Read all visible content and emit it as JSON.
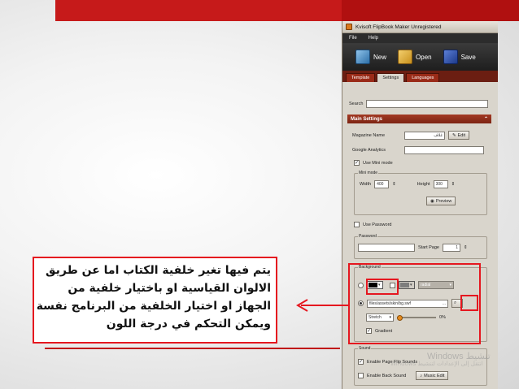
{
  "window": {
    "title": "Kvisoft FlipBook Maker  Unregistered"
  },
  "menu": [
    "File",
    "Help"
  ],
  "toolbar": {
    "new_label": "New",
    "open_label": "Open",
    "save_label": "Save"
  },
  "tabs": [
    {
      "label": "Template",
      "active": false
    },
    {
      "label": "Settings",
      "active": true
    },
    {
      "label": "Languages",
      "active": false
    }
  ],
  "search": {
    "label": "Search",
    "value": ""
  },
  "main_settings": {
    "title": "Main Settings",
    "magazine_name": {
      "label": "Magazine Name",
      "value": "غلاف",
      "edit_label": "Edit"
    },
    "google_analytics": {
      "label": "Google Analytics",
      "value": ""
    },
    "use_mini_mode": {
      "label": "Use Mini mode",
      "checked": true
    },
    "mini_mode": {
      "group_label": "Mini mode",
      "width_label": "Width",
      "width_value": "400",
      "height_label": "Height",
      "height_value": "300",
      "preview_label": "Preview"
    },
    "use_password": {
      "label": "Use Password",
      "checked": false
    },
    "password": {
      "group_label": "Password",
      "value": "",
      "start_page_label": "Start Page",
      "start_page_value": "1"
    },
    "background": {
      "group_label": "Background",
      "color1": "#000000",
      "color2": "#7d7d7d",
      "gradient_type": "radial",
      "file_path": "files/assets/skin/bg.swf",
      "browse_label": "...",
      "stretch_label": "Stretch",
      "opacity_percent": "0%",
      "gradient_label": "Gradient",
      "gradient_checked": true
    },
    "sound": {
      "group_label": "Sound",
      "flip_label": "Enable Page Flip Sounds",
      "flip_checked": true,
      "back_label": "Enable Back Sound",
      "back_checked": false,
      "music_edit_label": "Music Edit"
    }
  },
  "callout": {
    "lines": [
      "يتم فيها تغير خلفية الكتاب اما عن طريق",
      "الالوان القياسية او باختيار خلفية من",
      "الجهاز او اختيار الخلفية من البرنامج نفسة",
      "ويمكن التحكم في درجة اللون"
    ]
  },
  "watermark": {
    "line1": "Windows تنشيط",
    "line2": "انتقل إلى الإعدادات لتنشيط Windows"
  },
  "colors": {
    "accent_red": "#e5171f",
    "banner_red": "#c61a1a"
  }
}
